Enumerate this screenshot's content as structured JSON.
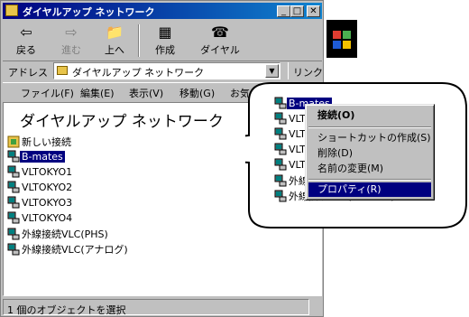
{
  "window": {
    "title": "ダイヤルアップ ネットワーク"
  },
  "toolbar": {
    "back_label": "戻る",
    "forward_label": "進む",
    "up_label": "上へ",
    "create_label": "作成",
    "dial_label": "ダイヤル"
  },
  "address": {
    "label": "アドレス",
    "value": "ダイヤルアップ ネットワーク",
    "links_label": "リンク"
  },
  "menu": [
    "ファイル(F)",
    "編集(E)",
    "表示(V)",
    "移動(G)",
    "お気に"
  ],
  "content": {
    "heading": "ダイヤルアップ ネットワーク",
    "items": [
      {
        "label": "新しい接続"
      },
      {
        "label": "B-mates"
      },
      {
        "label": "VLTOKYO1"
      },
      {
        "label": "VLTOKYO2"
      },
      {
        "label": "VLTOKYO3"
      },
      {
        "label": "VLTOKYO4"
      },
      {
        "label": "外線接続VLC(PHS)"
      },
      {
        "label": "外線接続VLC(アナログ)"
      }
    ]
  },
  "zoom": {
    "items": [
      {
        "label": "B-mates"
      },
      {
        "label": "VLT"
      },
      {
        "label": "VLT"
      },
      {
        "label": "VLT"
      },
      {
        "label": "VLT"
      },
      {
        "label": "外線"
      },
      {
        "label": "外線接続VLC(アナログ)"
      }
    ]
  },
  "context_menu": {
    "connect": "接続(O)",
    "create_shortcut": "ショートカットの作成(S)",
    "delete": "削除(D)",
    "rename": "名前の変更(M)",
    "properties": "プロパティ(R)"
  },
  "status": {
    "text": "1 個のオブジェクトを選択"
  },
  "colors": {
    "title_bar": "#000080",
    "selection": "#000080",
    "face": "#c0c0c0"
  }
}
